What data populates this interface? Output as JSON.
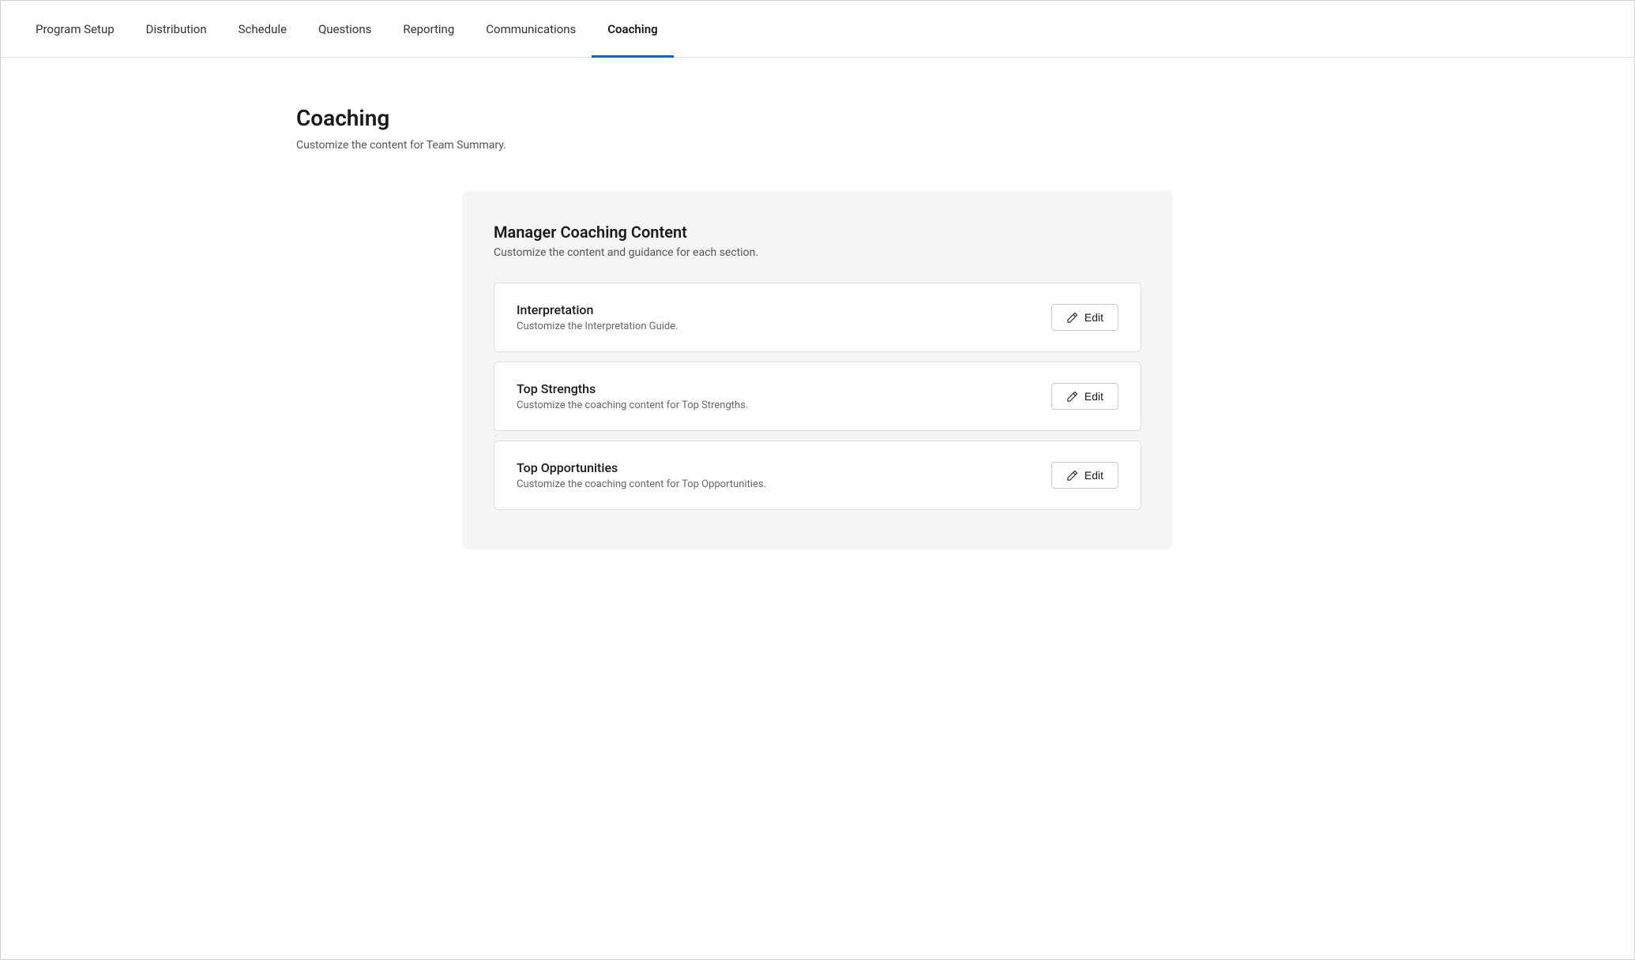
{
  "nav": {
    "items": [
      {
        "id": "program-setup",
        "label": "Program Setup",
        "active": false
      },
      {
        "id": "distribution",
        "label": "Distribution",
        "active": false
      },
      {
        "id": "schedule",
        "label": "Schedule",
        "active": false
      },
      {
        "id": "questions",
        "label": "Questions",
        "active": false
      },
      {
        "id": "reporting",
        "label": "Reporting",
        "active": false
      },
      {
        "id": "communications",
        "label": "Communications",
        "active": false
      },
      {
        "id": "coaching",
        "label": "Coaching",
        "active": true
      }
    ]
  },
  "page": {
    "title": "Coaching",
    "subtitle": "Customize the content for Team Summary."
  },
  "coaching_card": {
    "title": "Manager Coaching Content",
    "subtitle": "Customize the content and guidance for each section.",
    "sections": [
      {
        "id": "interpretation",
        "title": "Interpretation",
        "description": "Customize the Interpretation Guide.",
        "edit_label": "Edit"
      },
      {
        "id": "top-strengths",
        "title": "Top Strengths",
        "description": "Customize the coaching content for Top Strengths.",
        "edit_label": "Edit"
      },
      {
        "id": "top-opportunities",
        "title": "Top Opportunities",
        "description": "Customize the coaching content for Top Opportunities.",
        "edit_label": "Edit"
      }
    ]
  },
  "icons": {
    "edit": "✏"
  }
}
